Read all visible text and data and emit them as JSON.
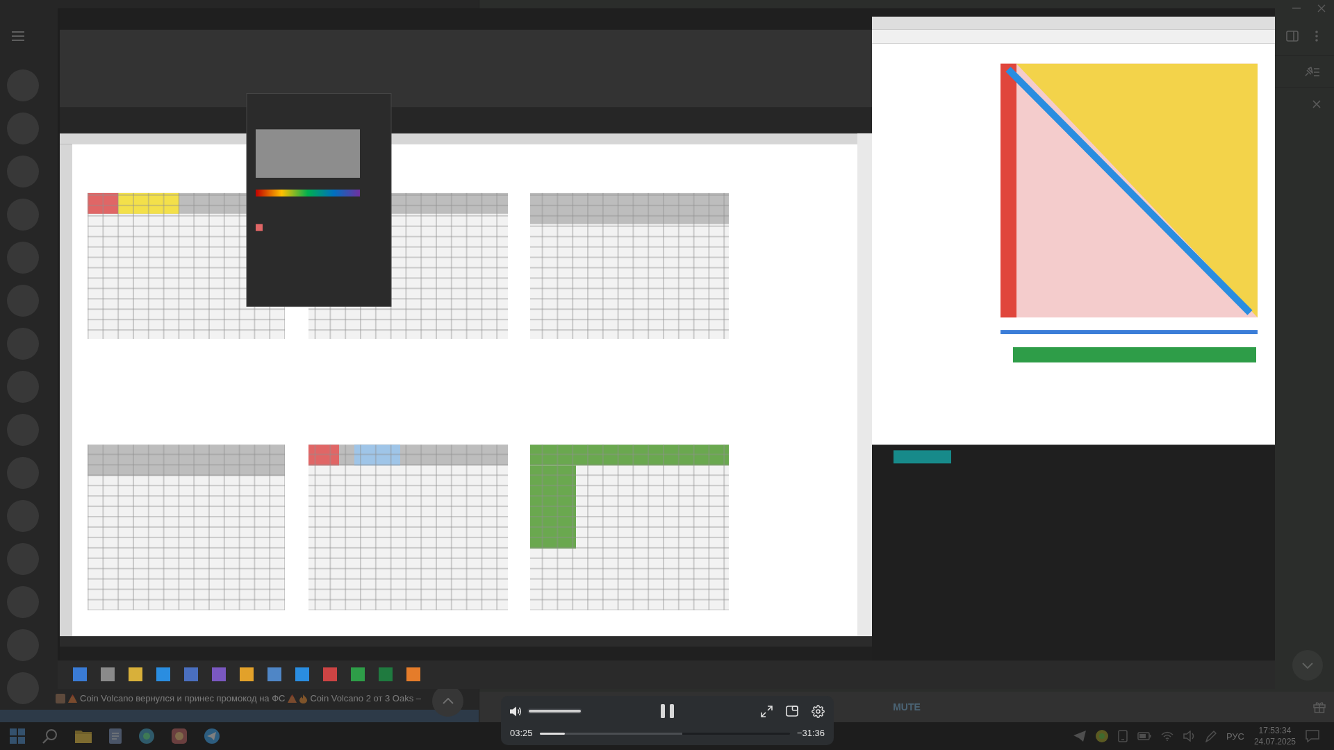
{
  "video_player": {
    "playing": true,
    "volume": {
      "level": 1
    },
    "current_time": "03:25",
    "progress": {
      "level": 0.1
    },
    "buffered": {
      "level": 0.57
    },
    "remaining_time": "−31:36"
  },
  "chat_list": {
    "chats": [
      {
        "selected": false
      },
      {
        "selected": false
      },
      {
        "selected": false
      },
      {
        "selected": false
      },
      {
        "selected": false
      },
      {
        "selected": false
      },
      {
        "selected": false
      },
      {
        "selected": false
      },
      {
        "selected": false
      },
      {
        "selected": false
      },
      {
        "selected": false
      },
      {
        "selected": false
      },
      {
        "selected": false
      },
      {
        "selected": false
      },
      {
        "selected": false,
        "preview_parts": [
          {
            "kind": "photo"
          },
          {
            "kind": "volcano"
          },
          {
            "kind": "text",
            "text": "Coin Volcano вернулся и принес промокод на ФС"
          },
          {
            "kind": "volcano"
          },
          {
            "kind": "fire"
          },
          {
            "kind": "text",
            "text": "Coin Volcano 2 от 3 Oaks –"
          }
        ]
      },
      {
        "selected": true
      }
    ]
  },
  "chat": {
    "mute_button": "MUTE"
  },
  "taskbar": {
    "language": "РУС",
    "time": "17:53:34",
    "date": "24.07.2025"
  }
}
